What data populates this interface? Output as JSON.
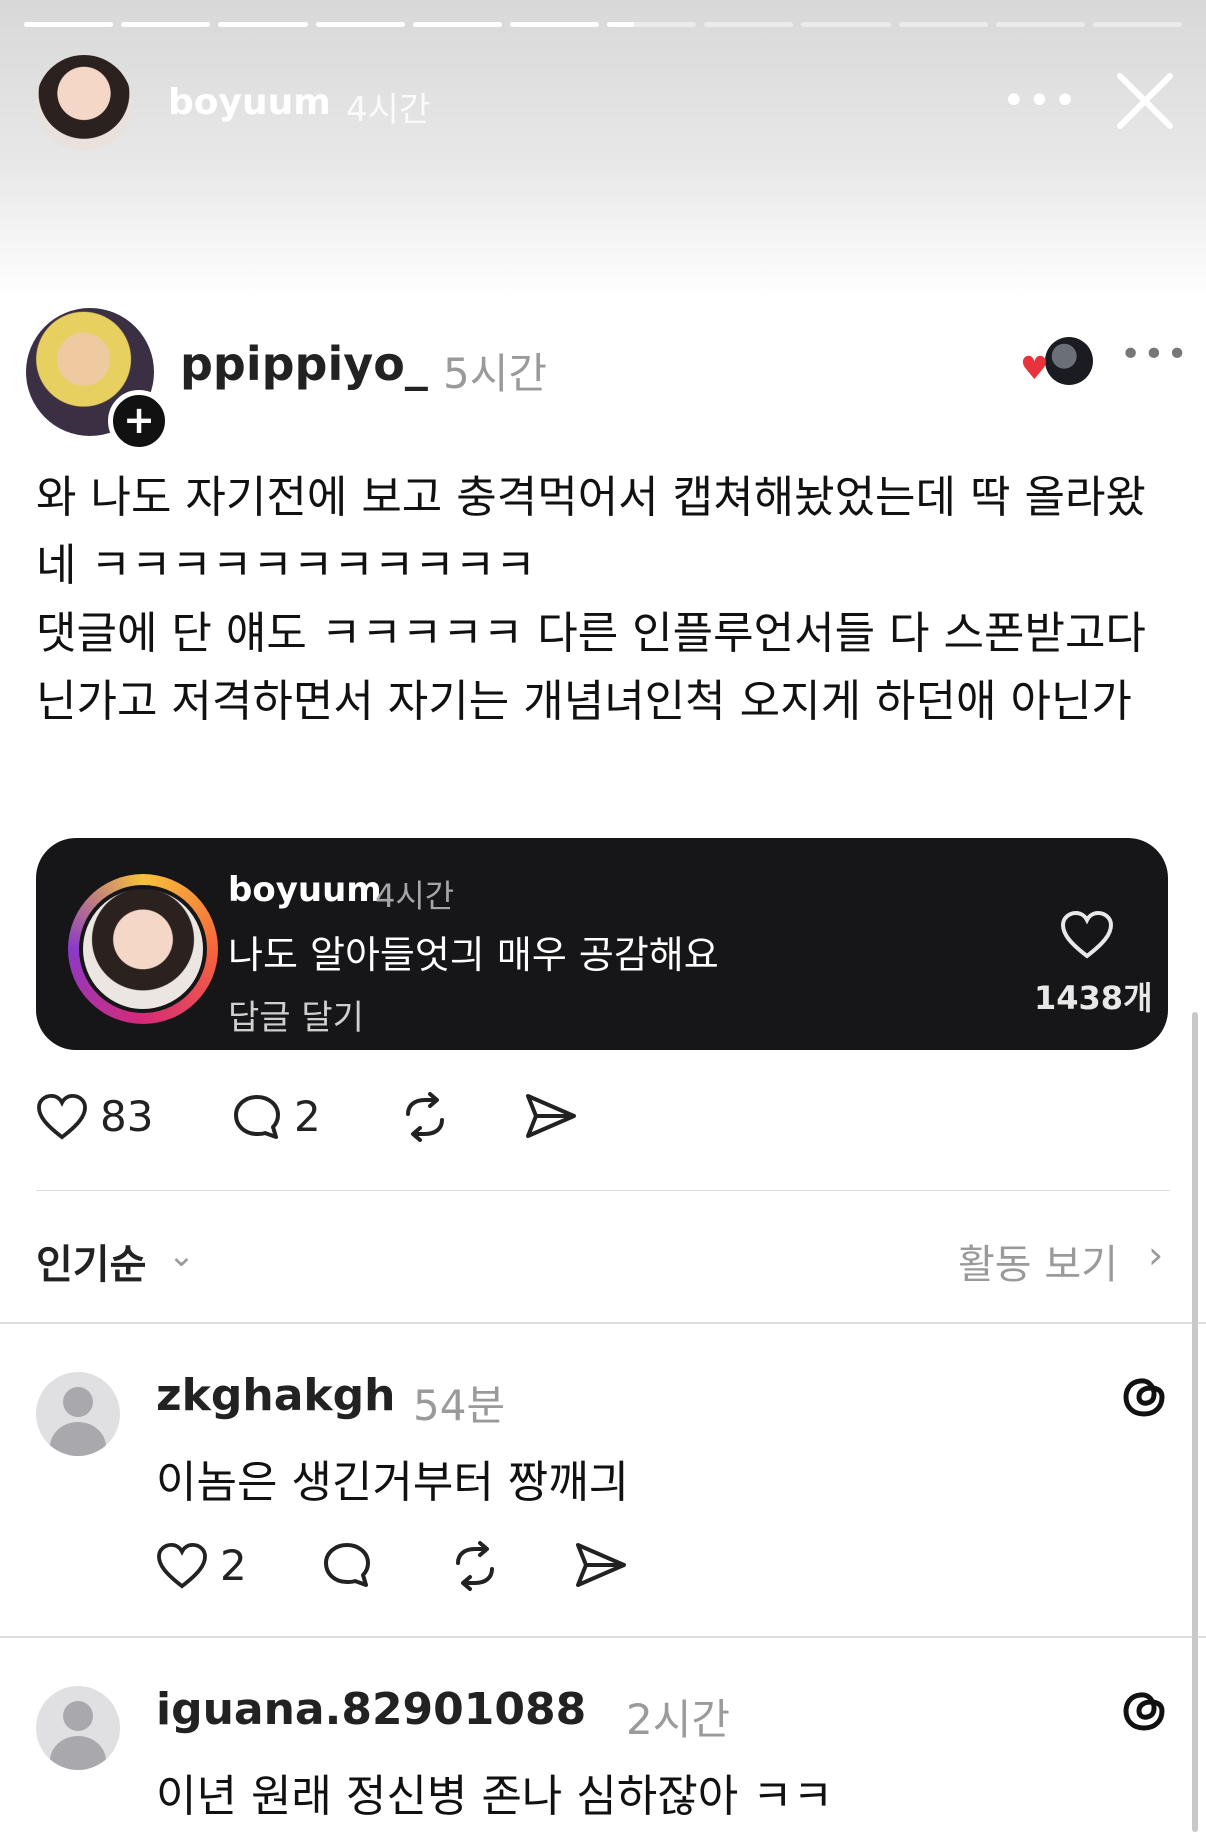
{
  "story": {
    "username": "boyuum",
    "time": "4시간",
    "progress": {
      "segments": 12,
      "current_index": 6,
      "current_fraction": 0.3
    },
    "more_label": "•••"
  },
  "thread": {
    "username": "ppippiyo_",
    "time": "5시간",
    "follow_label": "+",
    "more_label": "•••",
    "body": [
      "와 나도 자기전에 보고 충격먹어서 캡쳐해놨었는데 딱 올라왔네 ㅋㅋㅋㅋㅋㅋㅋㅋㅋㅋㅋ",
      "댓글에 단 얘도 ㅋㅋㅋㅋㅋ 다른 인플루언서들 다 스폰받고다닌가고 저격하면서 자기는 개념녀인척 오지게 하던애 아닌가"
    ],
    "quoted": {
      "username": "boyuum",
      "time": "4시간",
      "text": "나도 알아들엇긔 매우 공감해요",
      "reply_label": "답글 달기",
      "like_count": "1438개"
    },
    "actions": {
      "likes": "83",
      "comments": "2"
    }
  },
  "sort": {
    "label": "인기순",
    "activity_label": "활동 보기"
  },
  "comments": [
    {
      "username": "zkghakgh",
      "time": "54분",
      "text": "이놈은 생긴거부터 짱깨긔",
      "likes": "2"
    },
    {
      "username": "iguana.82901088",
      "time": "2시간",
      "text": "이년 원래 정신병 존나 심하잖아 ㅋㅋ"
    }
  ]
}
